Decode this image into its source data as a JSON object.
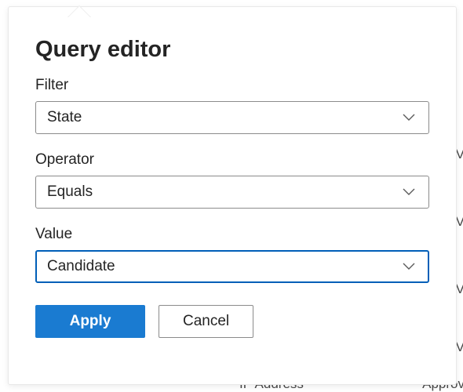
{
  "panel": {
    "title": "Query editor",
    "fields": {
      "filter": {
        "label": "Filter",
        "value": "State"
      },
      "operator": {
        "label": "Operator",
        "value": "Equals"
      },
      "value": {
        "label": "Value",
        "value": "Candidate"
      }
    },
    "buttons": {
      "apply": "Apply",
      "cancel": "Cancel"
    }
  },
  "background": {
    "rightChar": "V",
    "bottomLeft": "IP Address",
    "bottomRight": "Approv"
  }
}
